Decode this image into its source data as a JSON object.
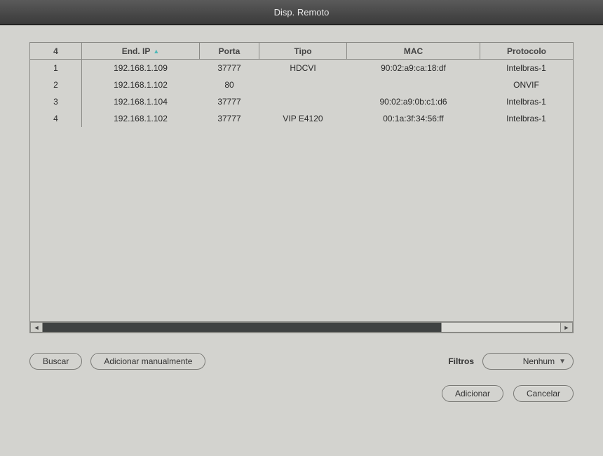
{
  "title": "Disp. Remoto",
  "table": {
    "count": "4",
    "headers": {
      "ip": "End. IP",
      "port": "Porta",
      "type": "Tipo",
      "mac": "MAC",
      "protocol": "Protocolo"
    },
    "sort_column": "ip",
    "rows": [
      {
        "idx": "1",
        "ip": "192.168.1.109",
        "port": "37777",
        "type": "HDCVI",
        "mac": "90:02:a9:ca:18:df",
        "protocol": "Intelbras-1"
      },
      {
        "idx": "2",
        "ip": "192.168.1.102",
        "port": "80",
        "type": "",
        "mac": "",
        "protocol": "ONVIF"
      },
      {
        "idx": "3",
        "ip": "192.168.1.104",
        "port": "37777",
        "type": "",
        "mac": "90:02:a9:0b:c1:d6",
        "protocol": "Intelbras-1"
      },
      {
        "idx": "4",
        "ip": "192.168.1.102",
        "port": "37777",
        "type": "VIP E4120",
        "mac": "00:1a:3f:34:56:ff",
        "protocol": "Intelbras-1"
      }
    ]
  },
  "buttons": {
    "search": "Buscar",
    "add_manually": "Adicionar manualmente",
    "add": "Adicionar",
    "cancel": "Cancelar"
  },
  "filters": {
    "label": "Filtros",
    "selected": "Nenhum"
  }
}
